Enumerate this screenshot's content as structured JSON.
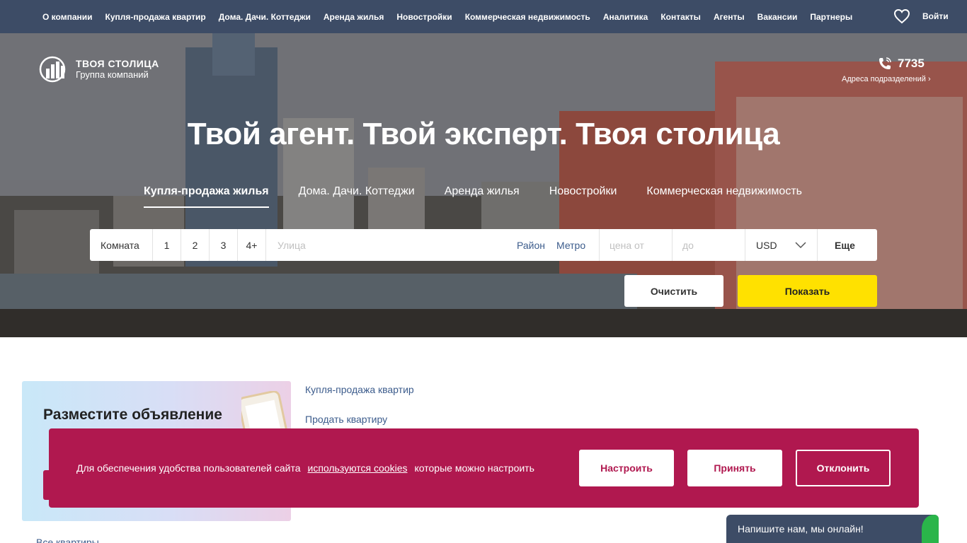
{
  "nav": {
    "items": [
      "О компании",
      "Купля-продажа квартир",
      "Дома. Дачи. Коттеджи",
      "Аренда жилья",
      "Новостройки",
      "Коммерческая недвижимость",
      "Аналитика",
      "Контакты",
      "Агенты",
      "Вакансии",
      "Партнеры"
    ],
    "login": "Войти"
  },
  "brand": {
    "name": "ТВОЯ СТОЛИЦА",
    "subtitle": "Группа компаний"
  },
  "contact": {
    "phone": "7735",
    "branches": "Адреса подразделений ›"
  },
  "hero": {
    "headline": "Твой агент. Твой эксперт. Твоя столица",
    "tabs": [
      "Купля-продажа жилья",
      "Дома. Дачи. Коттеджи",
      "Аренда жилья",
      "Новостройки",
      "Коммерческая недвижимость"
    ]
  },
  "search": {
    "rooms_label": "Комната",
    "rooms": [
      "1",
      "2",
      "3",
      "4+"
    ],
    "street_placeholder": "Улица",
    "district": "Район",
    "metro": "Метро",
    "price_from_placeholder": "цена от",
    "price_to_placeholder": "до",
    "currency": "USD",
    "more": "Еще",
    "clear": "Очистить",
    "show": "Показать"
  },
  "promo": {
    "title": "Разместите объявление"
  },
  "links": [
    "Купля-продажа квартир",
    "Продать квартиру"
  ],
  "all_apartments": "Все квартиры",
  "cookie": {
    "text_before": "Для обеспечения удобства пользователей сайта",
    "link": "используются cookies",
    "text_after": "которые можно настроить",
    "configure": "Настроить",
    "accept": "Принять",
    "decline": "Отклонить"
  },
  "chat": {
    "label": "Напишите нам, мы онлайн!"
  },
  "colors": {
    "nav_bg": "#3d4c66",
    "accent_yellow": "#ffe100",
    "cookie_bg": "#b0184f",
    "link": "#3c5c8c"
  }
}
